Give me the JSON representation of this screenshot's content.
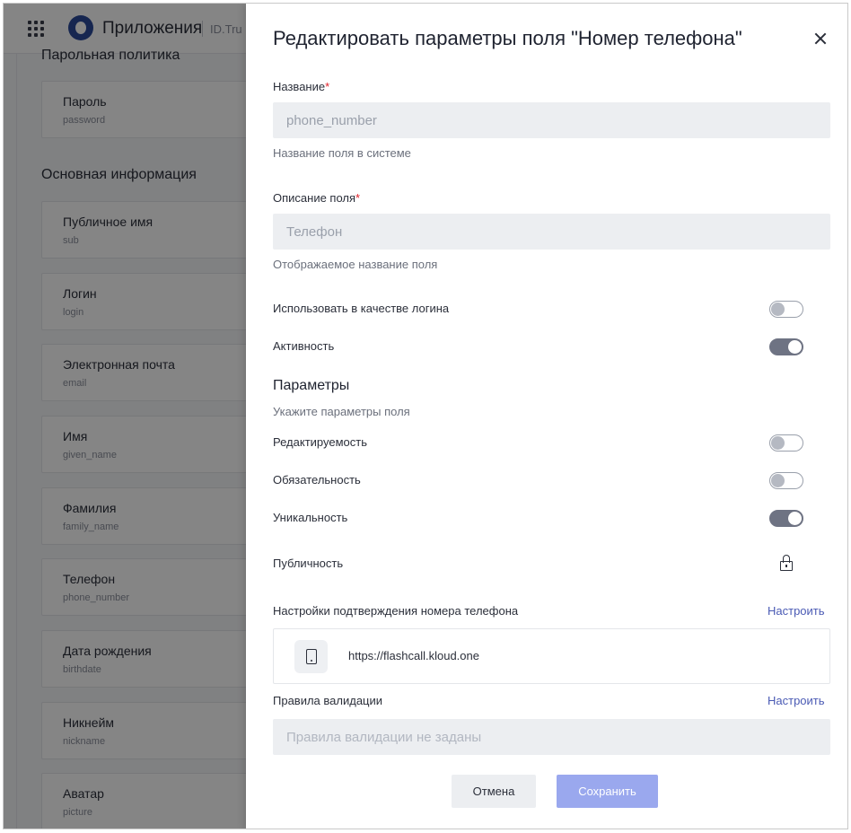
{
  "app": {
    "title": "Приложения",
    "subtitle": "ID.Tru"
  },
  "background": {
    "sections": [
      {
        "title": "Парольная политика"
      },
      {
        "title": "Основная информация"
      }
    ],
    "fields": [
      {
        "label": "Пароль",
        "sub": "password"
      },
      {
        "label": "Публичное имя",
        "sub": "sub"
      },
      {
        "label": "Логин",
        "sub": "login"
      },
      {
        "label": "Электронная почта",
        "sub": "email"
      },
      {
        "label": "Имя",
        "sub": "given_name"
      },
      {
        "label": "Фамилия",
        "sub": "family_name"
      },
      {
        "label": "Телефон",
        "sub": "phone_number"
      },
      {
        "label": "Дата рождения",
        "sub": "birthdate"
      },
      {
        "label": "Никнейм",
        "sub": "nickname"
      },
      {
        "label": "Аватар",
        "sub": "picture"
      }
    ]
  },
  "drawer": {
    "title": "Редактировать параметры поля \"Номер телефона\"",
    "name_field": {
      "label": "Название",
      "required_mark": "*",
      "value": "phone_number",
      "hint": "Название поля в системе"
    },
    "description_field": {
      "label": "Описание поля",
      "required_mark": "*",
      "value": "Телефон",
      "hint": "Отображаемое название поля"
    },
    "use_as_login": {
      "label": "Использовать в качестве логина",
      "on": false
    },
    "activity": {
      "label": "Активность",
      "on": true
    },
    "params": {
      "title": "Параметры",
      "subtitle": "Укажите параметры поля",
      "editable": {
        "label": "Редактируемость",
        "on": false
      },
      "required": {
        "label": "Обязательность",
        "on": false
      },
      "unique": {
        "label": "Уникальность",
        "on": true
      },
      "public": {
        "label": "Публичность",
        "icon": "lock-icon"
      }
    },
    "phone_confirmation": {
      "label": "Настройки подтверждения номера телефона",
      "link": "Настроить",
      "provider_icon": "phone-icon",
      "provider_url": "https://flashcall.kloud.one"
    },
    "validation": {
      "label": "Правила валидации",
      "link": "Настроить",
      "placeholder": "Правила валидации не заданы"
    },
    "buttons": {
      "cancel": "Отмена",
      "save": "Сохранить"
    }
  }
}
